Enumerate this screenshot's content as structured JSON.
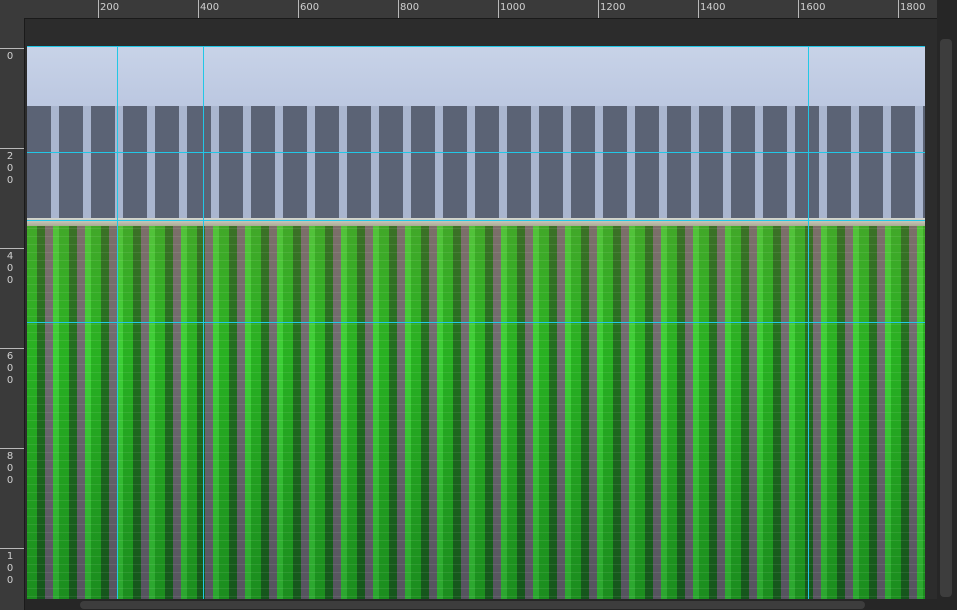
{
  "ruler_top": {
    "labels": [
      "200",
      "400",
      "600",
      "800",
      "1000",
      "1200",
      "1400",
      "1600",
      "1800"
    ]
  },
  "ruler_left": {
    "labels": [
      "0",
      "2\n0\n0",
      "4\n0\n0",
      "6\n0\n0",
      "8\n0\n0",
      "1\n0\n0"
    ]
  },
  "icons": {
    "guide": "guide-line",
    "scroll": "scrollbar"
  },
  "colors": {
    "guide": "#22c7e6",
    "panel": "#262626",
    "ruler": "#3a3a3a"
  }
}
